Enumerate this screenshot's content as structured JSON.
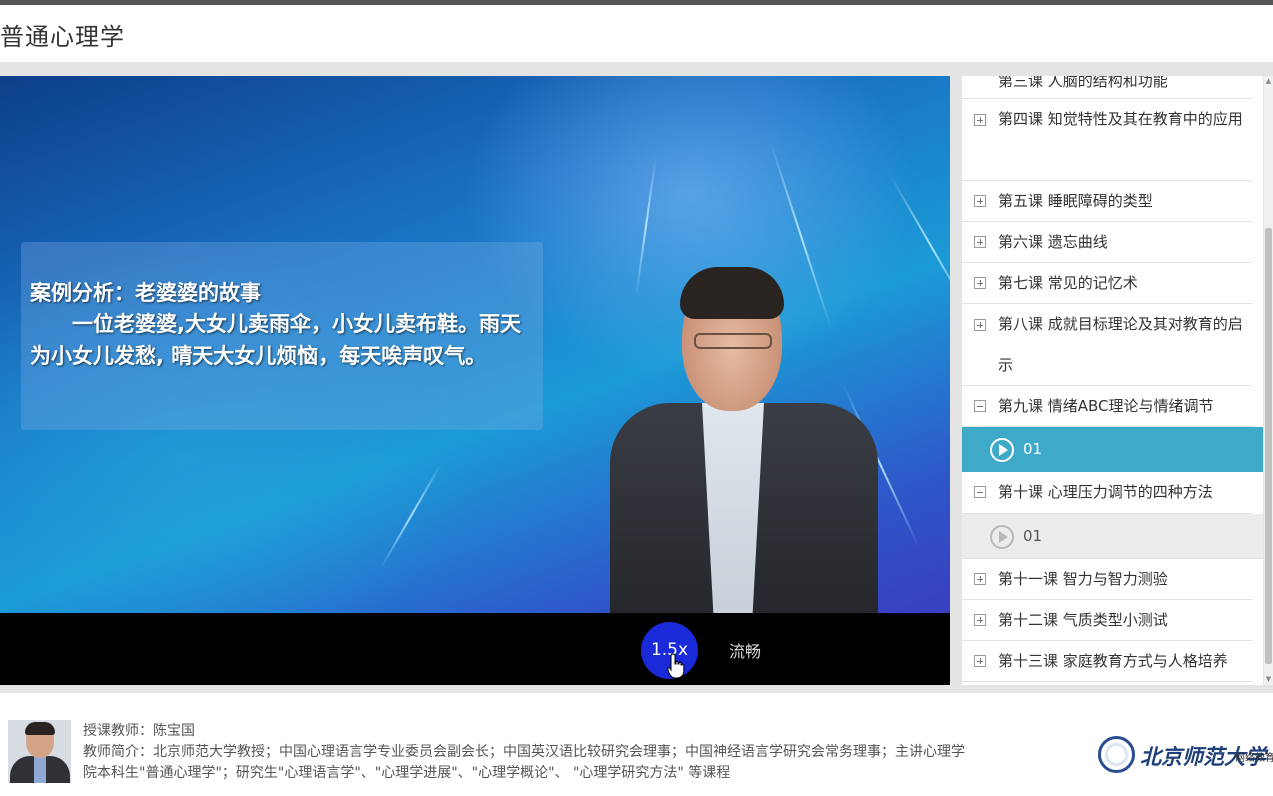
{
  "header": {
    "title": "普通心理学"
  },
  "video": {
    "slide_title": "案例分析：老婆婆的故事",
    "slide_body": "一位老婆婆,大女儿卖雨伞，小女儿卖布鞋。雨天为小女儿发愁, 晴天大女儿烦恼，每天唉声叹气。",
    "speed_label": "1.5x",
    "quality_label": "流畅"
  },
  "sidebar": {
    "lessons": [
      {
        "label": "第三课 人脑的结构和功能",
        "icon": "plus-square-icon"
      },
      {
        "label": "第四课 知觉特性及其在教育中的应用",
        "icon": "plus-square-icon"
      },
      {
        "label": "第五课 睡眠障碍的类型",
        "icon": "plus-square-icon"
      },
      {
        "label": "第六课 遗忘曲线",
        "icon": "plus-square-icon"
      },
      {
        "label": "第七课 常见的记忆术",
        "icon": "plus-square-icon"
      },
      {
        "label": "第八课 成就目标理论及其对教育的启示",
        "icon": "plus-square-icon"
      },
      {
        "label": "第九课 情绪ABC理论与情绪调节",
        "icon": "minus-square-icon",
        "expanded": true,
        "sub_items": [
          {
            "label": "01",
            "active": true
          }
        ]
      },
      {
        "label": "第十课 心理压力调节的四种方法",
        "icon": "minus-square-icon",
        "expanded": true,
        "sub_items": [
          {
            "label": "01",
            "active": false
          }
        ]
      },
      {
        "label": "第十一课 智力与智力测验",
        "icon": "plus-square-icon"
      },
      {
        "label": "第十二课 气质类型小测试",
        "icon": "plus-square-icon"
      },
      {
        "label": "第十三课 家庭教育方式与人格培养",
        "icon": "plus-square-icon"
      }
    ]
  },
  "footer": {
    "teacher": "授课教师：陈宝国",
    "intro": "教师简介：北京师范大学教授；中国心理语言学专业委员会副会长；中国英汉语比较研究会理事；中国神经语言学研究会常务理事；主讲心理学院本科生\"普通心理学\"；研究生\"心理语言学\"、\"心理学进展\"、\"心理学概论\"、 \"心理学研究方法\" 等课程",
    "logo": {
      "name": "北京师范大学",
      "subtitle": "网络教育"
    }
  },
  "colors": {
    "active_item": "#3fa9c8",
    "speed_button": "#1a2ad8",
    "header_bar": "#555555"
  }
}
